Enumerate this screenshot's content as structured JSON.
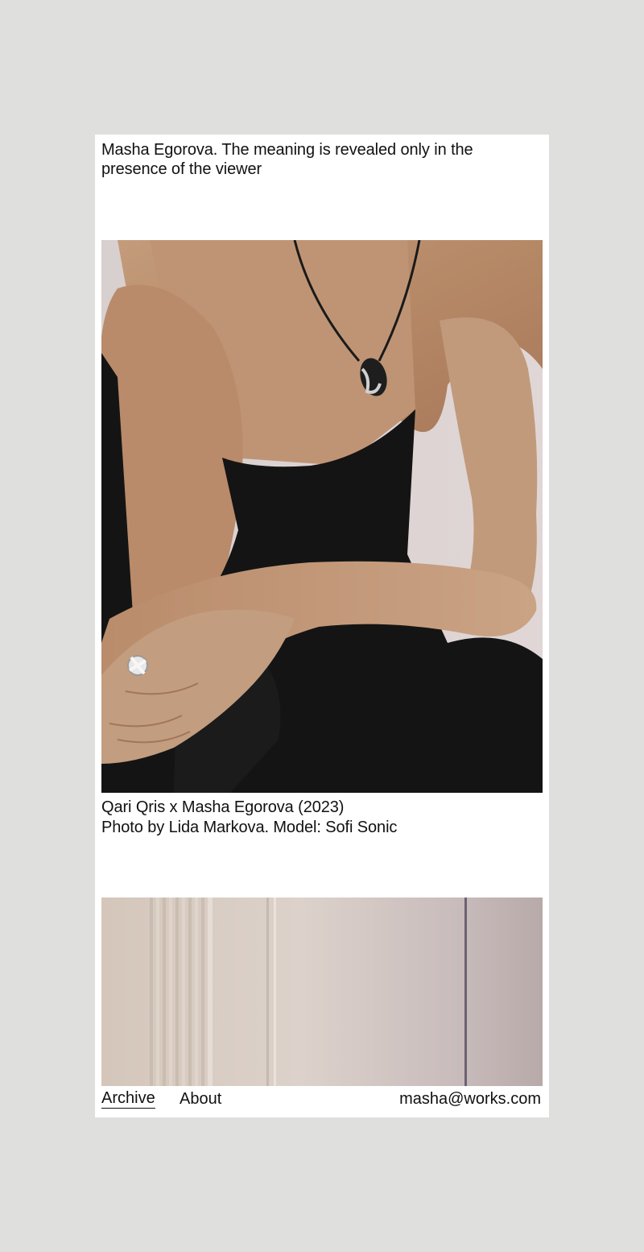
{
  "header": {
    "title": "Masha Egorova. The meaning is revealed only in the presence of the viewer"
  },
  "works": [
    {
      "image": "photo-model-necklace-ring",
      "caption_line1": "Qari Qris x Masha Egorova (2023)",
      "caption_line2": "Photo by Lida Markova. Model: Sofi Sonic"
    },
    {
      "image": "photo-wall-detail"
    }
  ],
  "nav": {
    "archive": "Archive",
    "about": "About",
    "email": "masha@works.com",
    "active": "Archive"
  },
  "colors": {
    "page_background": "#dfdfdd",
    "card_background": "#ffffff",
    "text": "#111111"
  }
}
